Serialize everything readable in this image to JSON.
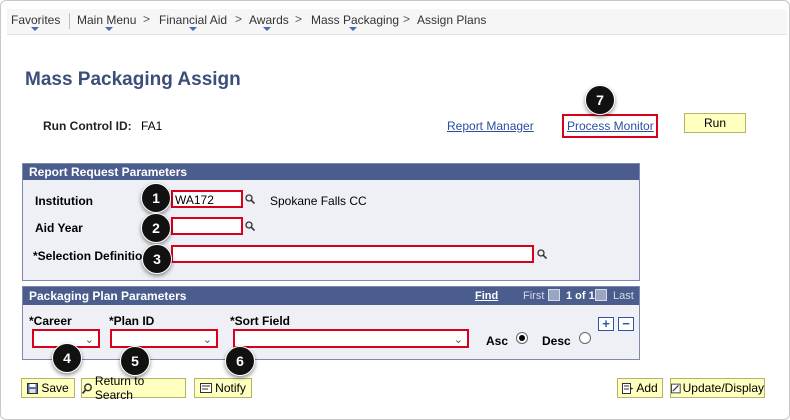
{
  "breadcrumb": {
    "favorites": "Favorites",
    "main_menu": "Main Menu",
    "financial_aid": "Financial Aid",
    "awards": "Awards",
    "mass_packaging": "Mass Packaging",
    "assign_plans": "Assign Plans"
  },
  "page": {
    "title": "Mass Packaging Assign",
    "run_control_label": "Run Control ID:",
    "run_control_value": "FA1",
    "report_manager": "Report Manager",
    "process_monitor": "Process Monitor",
    "run_button": "Run"
  },
  "report_params": {
    "header": "Report Request Parameters",
    "institution_label": "Institution",
    "institution_value": "WA172",
    "institution_desc": "Spokane Falls CC",
    "aid_year_label": "Aid Year",
    "aid_year_value": "",
    "selection_label": "*Selection Definition",
    "selection_value": ""
  },
  "plan_params": {
    "header": "Packaging Plan Parameters",
    "find": "Find",
    "first": "First",
    "counter": "1 of 1",
    "last": "Last",
    "career_label": "*Career",
    "plan_id_label": "*Plan ID",
    "sort_field_label": "*Sort Field",
    "asc_label": "Asc",
    "desc_label": "Desc",
    "sort_order": "Asc"
  },
  "toolbar": {
    "save": "Save",
    "return_to_search": "Return to Search",
    "notify": "Notify",
    "add": "Add",
    "update_display": "Update/Display"
  },
  "callouts": [
    "1",
    "2",
    "3",
    "4",
    "5",
    "6",
    "7"
  ],
  "colors": {
    "header_bg": "#4b5d8c",
    "title": "#3c4f7a",
    "button_bg": "#ffffc0",
    "highlight": "#d9001b",
    "link": "#2a4fa0"
  }
}
